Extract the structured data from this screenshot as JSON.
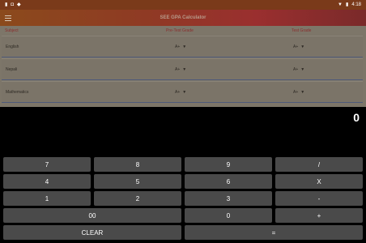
{
  "status_bar": {
    "time": "4:18",
    "left_icons": [
      "sd-card-icon",
      "notification-icon",
      "shield-icon"
    ],
    "right_icons": [
      "wifi-icon",
      "battery-icon"
    ]
  },
  "app_bar": {
    "title": "SEE GPA Calculator"
  },
  "table": {
    "headers": {
      "subject": "Subject",
      "pre_test": "Pre-Test Grade",
      "test": "Test Grade"
    },
    "rows": [
      {
        "subject": "English",
        "pre_grade": "A+",
        "test_grade": "A+"
      },
      {
        "subject": "Nepali",
        "pre_grade": "A+",
        "test_grade": "A+"
      },
      {
        "subject": "Mathematics",
        "pre_grade": "A+",
        "test_grade": "A+"
      }
    ]
  },
  "display": {
    "value": "0"
  },
  "keypad": {
    "row1": [
      "7",
      "8",
      "9",
      "/"
    ],
    "row2": [
      "4",
      "5",
      "6",
      "X"
    ],
    "row3": [
      "1",
      "2",
      "3",
      "-"
    ],
    "row4": [
      "00",
      "0",
      "+"
    ],
    "row5": [
      "CLEAR",
      "="
    ]
  },
  "colors": {
    "background": "#000000",
    "content_bg": "#7d7669",
    "key_bg": "#4a4a4a",
    "header_text": "#8a2e2e",
    "app_bar_start": "#8b4a1c",
    "app_bar_end": "#7a2a2a"
  }
}
